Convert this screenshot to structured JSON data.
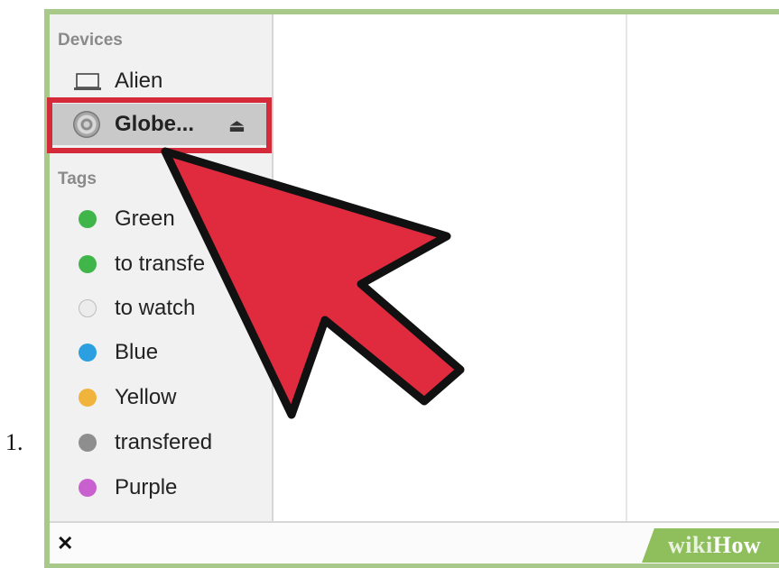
{
  "step_number": "1.",
  "sidebar": {
    "devices_heading": "Devices",
    "devices": [
      {
        "label": "Alien",
        "icon": "laptop-icon"
      },
      {
        "label": "Globe...",
        "icon": "disc-icon",
        "selected": true,
        "eject_glyph": "⏏"
      }
    ],
    "tags_heading": "Tags",
    "tags": [
      {
        "label": "Green",
        "color": "#3fb54a"
      },
      {
        "label": "to transfe",
        "color": "#3fb54a"
      },
      {
        "label": "to watch",
        "color": "#e9e9e9"
      },
      {
        "label": "Blue",
        "color": "#2c9fe0"
      },
      {
        "label": "Yellow",
        "color": "#f0b43c"
      },
      {
        "label": "transfered",
        "color": "#8e8e8e"
      },
      {
        "label": "Purple",
        "color": "#c860cf"
      }
    ]
  },
  "bottombar": {
    "tool_glyph": "✕"
  },
  "watermark": {
    "wiki": "wiki",
    "how": "How"
  },
  "colors": {
    "highlight": "#d42a3a",
    "arrow_fill": "#e02b3f",
    "frame": "#a9c98a"
  }
}
